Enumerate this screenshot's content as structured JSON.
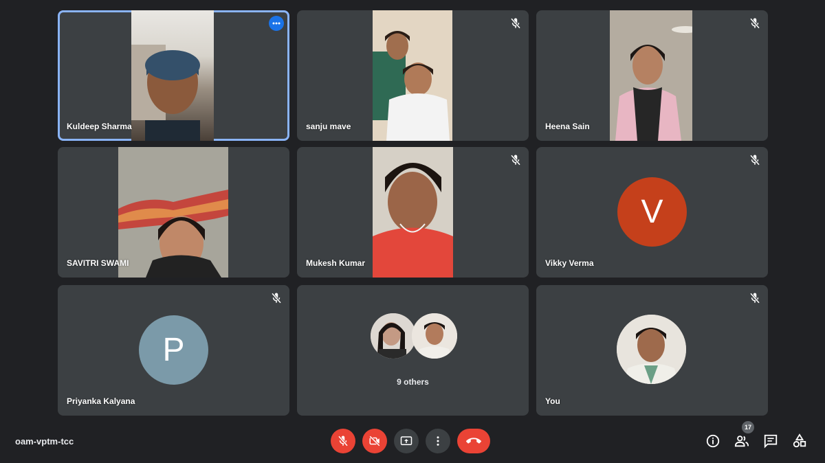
{
  "tiles": [
    {
      "name": "Kuldeep Sharma"
    },
    {
      "name": "sanju mave"
    },
    {
      "name": "Heena Sain"
    },
    {
      "name": "SAVITRI SWAMI"
    },
    {
      "name": "Mukesh Kumar"
    },
    {
      "name": "Vikky Verma",
      "initial": "V"
    },
    {
      "name": "Priyanka Kalyana",
      "initial": "P"
    },
    {
      "others_label": "9 others"
    },
    {
      "name": "You"
    }
  ],
  "bottom_bar": {
    "meeting_code": "oam-vptm-tcc",
    "participant_count": "17"
  },
  "colors": {
    "background": "#202124",
    "tile": "#3c4043",
    "active_outline": "#8ab4f8",
    "danger": "#ea4335",
    "vikky_avatar": "#c5401b",
    "priyanka_avatar": "#7b9aa9"
  },
  "icons": [
    "more-options-icon",
    "mic-off-icon",
    "camera-off-icon",
    "present-screen-icon",
    "more-vert-icon",
    "end-call-icon",
    "info-icon",
    "people-icon",
    "chat-icon",
    "activities-icon"
  ]
}
